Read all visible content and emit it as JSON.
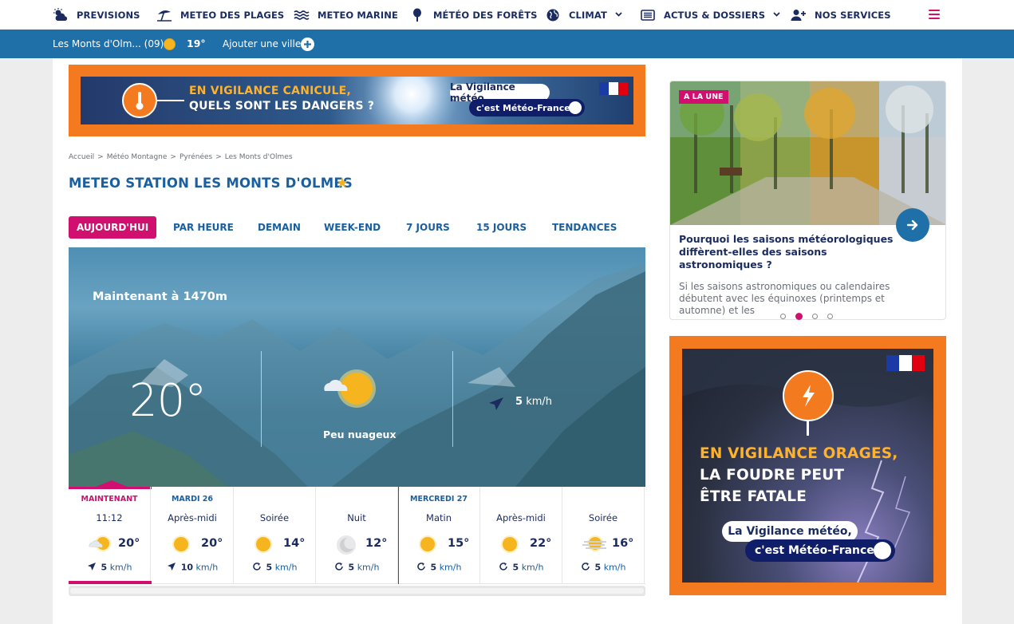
{
  "nav": {
    "items": [
      {
        "label": "PREVISIONS",
        "icon": "cloud-sun-icon"
      },
      {
        "label": "METEO DES PLAGES",
        "icon": "beach-umbrella-icon"
      },
      {
        "label": "METEO MARINE",
        "icon": "waves-icon"
      },
      {
        "label": "MÉTÉO DES FORÊTS",
        "icon": "tree-icon"
      },
      {
        "label": "CLIMAT",
        "icon": "globe-icon"
      },
      {
        "label": "ACTUS & DOSSIERS",
        "icon": "newspaper-icon"
      },
      {
        "label": "NOS SERVICES",
        "icon": "user-plus-icon"
      }
    ]
  },
  "citybar": {
    "city": "Les Monts d'Olm... (09)",
    "temp": "19°",
    "add_label": "Ajouter une ville"
  },
  "banner": {
    "title1": "EN VIGILANCE CANICULE,",
    "title2": "QUELS SONT LES DANGERS ?",
    "pill1": "La Vigilance météo,",
    "pill2": "c'est Météo-France"
  },
  "breadcrumb": [
    "Accueil",
    ">",
    "Météo Montagne",
    ">",
    "Pyrénées",
    ">",
    "Les Monts d'Olmes"
  ],
  "page_title": "METEO STATION LES MONTS D'OLMES",
  "tabs": [
    "AUJOURD'HUI",
    "PAR HEURE",
    "DEMAIN",
    "WEEK-END",
    "7 JOURS",
    "15 JOURS",
    "TENDANCES"
  ],
  "hero": {
    "label": "Maintenant à 1470m",
    "temp": "20°",
    "condition": "Peu nuageux",
    "wind_value": "5",
    "wind_unit": "km/h"
  },
  "forecast": [
    {
      "day": "MAINTENANT",
      "period": "11:12",
      "temp": "20°",
      "wind": "5",
      "unit": "km/h",
      "icon": "sun-cloud-icon",
      "wind_icon": "wind-arrow-icon"
    },
    {
      "day": "MARDI 26",
      "period": "Après-midi",
      "temp": "20°",
      "wind": "10",
      "unit": "km/h",
      "icon": "sun-icon",
      "wind_icon": "wind-arrow-icon"
    },
    {
      "day": "",
      "period": "Soirée",
      "temp": "14°",
      "wind": "5",
      "unit": "km/h",
      "icon": "sun-icon",
      "wind_icon": "variable-wind-icon"
    },
    {
      "day": "",
      "period": "Nuit",
      "temp": "12°",
      "wind": "5",
      "unit": "km/h",
      "icon": "moon-icon",
      "wind_icon": "variable-wind-icon"
    },
    {
      "day": "MERCREDI 27",
      "period": "Matin",
      "temp": "15°",
      "wind": "5",
      "unit": "km/h",
      "icon": "sun-icon",
      "wind_icon": "variable-wind-icon"
    },
    {
      "day": "",
      "period": "Après-midi",
      "temp": "22°",
      "wind": "5",
      "unit": "km/h",
      "icon": "sun-icon",
      "wind_icon": "variable-wind-icon"
    },
    {
      "day": "",
      "period": "Soirée",
      "temp": "16°",
      "wind": "5",
      "unit": "km/h",
      "icon": "sun-haze-icon",
      "wind_icon": "variable-wind-icon"
    }
  ],
  "card": {
    "tag": "A LA UNE",
    "title": "Pourquoi les saisons météorologiques diffèrent-elles des saisons astronomiques ?",
    "text": "Si les saisons astronomiques ou calendaires débutent avec les équinoxes (printemps et automne) et les"
  },
  "ad": {
    "t1": "EN VIGILANCE ORAGES,",
    "t2": "LA FOUDRE PEUT",
    "t3": "ÊTRE FATALE",
    "pill1": "La Vigilance météo,",
    "pill2": "c'est Météo-France"
  },
  "colors": {
    "accent": "#d10f6f",
    "primary": "#1f6fa8",
    "orange": "#f47a1f",
    "navy": "#1a2b5f"
  }
}
